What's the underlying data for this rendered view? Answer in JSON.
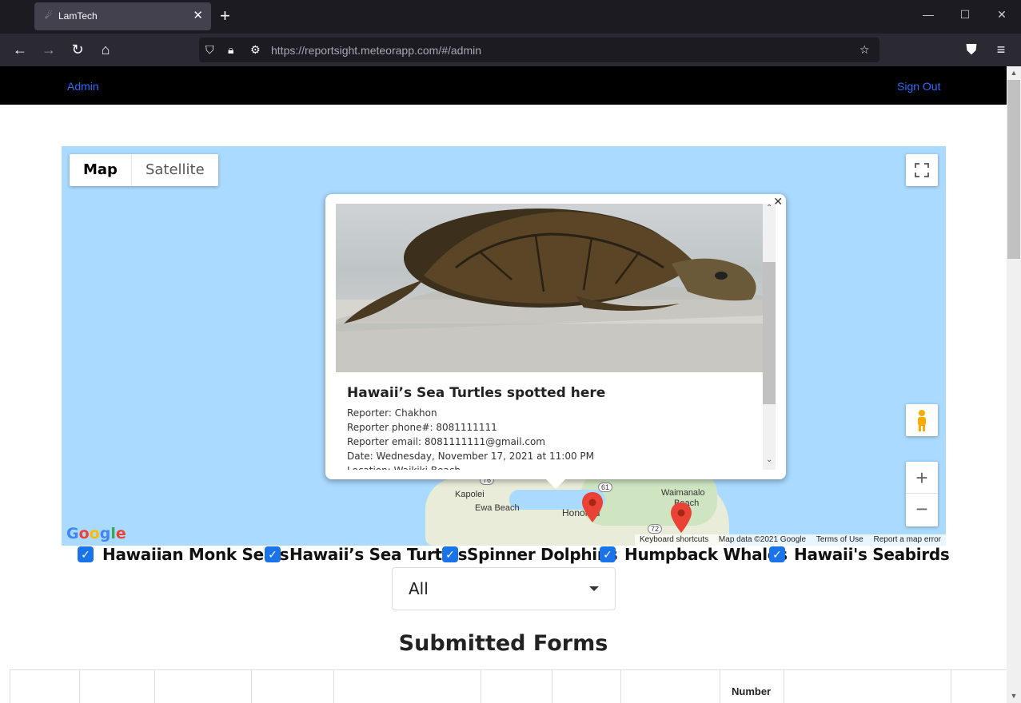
{
  "browser": {
    "tab_title": "LamTech",
    "url_host": "https://reportsight.meteorapp.com",
    "url_path": "/#/admin"
  },
  "nav": {
    "left_link": "Admin",
    "right_link": "Sign Out"
  },
  "map": {
    "type_map": "Map",
    "type_satellite": "Satellite",
    "labels": {
      "kapolei": "Kapolei",
      "ewa_beach": "Ewa Beach",
      "honolulu": "Honolulu",
      "waimanalo": "Waimanalo",
      "beach": "Beach",
      "route_61": "61",
      "route_72": "72",
      "route_76": "76"
    },
    "attribution": {
      "shortcuts": "Keyboard shortcuts",
      "data": "Map data ©2021 Google",
      "terms": "Terms of Use",
      "report": "Report a map error"
    },
    "logo": "Google",
    "infowindow": {
      "title": "Hawaii’s Sea Turtles spotted here",
      "reporter": "Reporter: Chakhon",
      "phone": "Reporter phone#: 8081111111",
      "email": "Reporter email: 8081111111@gmail.com",
      "date": "Date: Wednesday, November 17, 2021 at 11:00 PM",
      "location": "Location: Waikiki Beach"
    }
  },
  "filters": [
    {
      "label": "Hawaiian Monk Seals",
      "checked": true
    },
    {
      "label": "Hawaii’s Sea Turtles",
      "checked": true
    },
    {
      "label": "Spinner Dolphins",
      "checked": true
    },
    {
      "label": "Humpback Whales",
      "checked": true
    },
    {
      "label": "Hawaii's Seabirds",
      "checked": true
    }
  ],
  "select": {
    "value": "All"
  },
  "section_title": "Submitted Forms",
  "table": {
    "headers": [
      "",
      "",
      "",
      "",
      "",
      "",
      "",
      "",
      "Number",
      "",
      ""
    ]
  },
  "colors": {
    "accent": "#1a73e8",
    "map_water": "#aadaff",
    "pin": "#ea4335"
  }
}
